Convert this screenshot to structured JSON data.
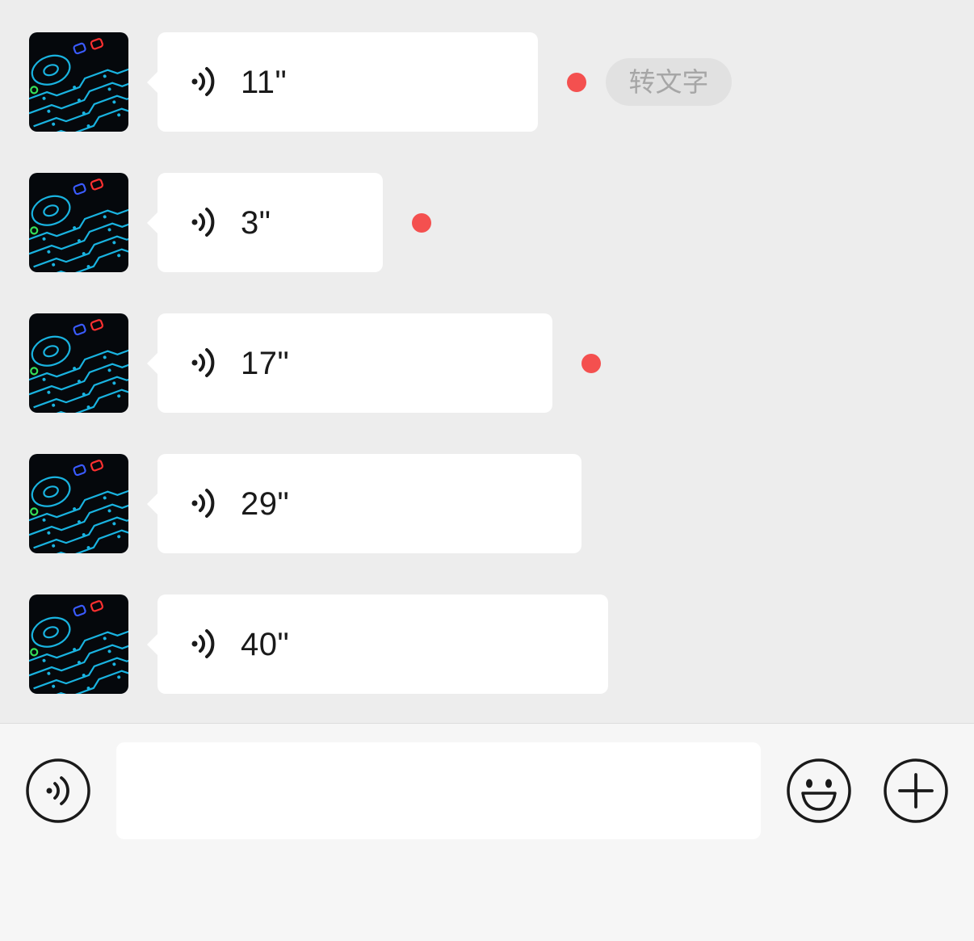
{
  "messages": [
    {
      "duration": "11\"",
      "unread": true,
      "transcribe_label": "转文字"
    },
    {
      "duration": "3\"",
      "unread": true
    },
    {
      "duration": "17\"",
      "unread": true
    },
    {
      "duration": "29\"",
      "unread": false
    },
    {
      "duration": "40\"",
      "unread": false
    }
  ],
  "input_bar": {
    "voice_toggle_icon": "voice-icon",
    "text_value": "",
    "emoji_icon": "smile-icon",
    "more_icon": "plus-icon"
  },
  "colors": {
    "chat_background": "#ededed",
    "bubble": "#ffffff",
    "unread_dot": "#f4504f",
    "input_bar_background": "#f6f6f6"
  }
}
